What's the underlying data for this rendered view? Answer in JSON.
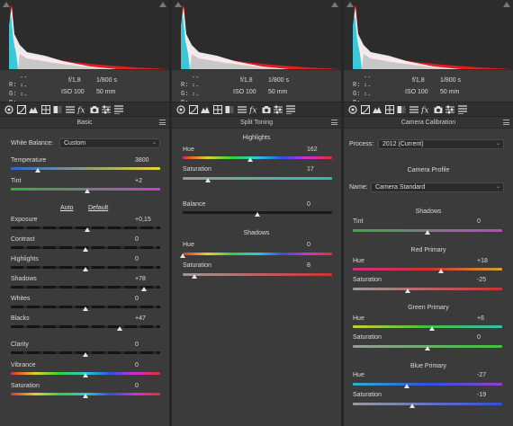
{
  "info": {
    "r_label": "R:",
    "g_label": "G:",
    "b_label": "B:",
    "r": "---",
    "g": "---",
    "b": "---",
    "aperture": "f/1,8",
    "shutter": "1/800 s",
    "iso": "ISO 100",
    "focal": "50 mm"
  },
  "colors": {
    "track_gray": "#1a1a1a",
    "temp": [
      "#2f66c8",
      "#e8d43a"
    ],
    "tint": [
      "#2fb23a",
      "#c63fd0"
    ],
    "rainbow": [
      "#e03030",
      "#e0d030",
      "#30d040",
      "#30c8d8",
      "#3050e0",
      "#d030d0",
      "#e03030"
    ]
  },
  "basic": {
    "title": "Basic",
    "wb_label": "White Balance:",
    "wb_value": "Custom",
    "temp_label": "Temperature",
    "temp_value": "3800",
    "temp_pos": 0.18,
    "tint_label": "Tint",
    "tint_value": "+2",
    "tint_pos": 0.51,
    "auto": "Auto",
    "default": "Default",
    "rows": [
      {
        "label": "Exposure",
        "value": "+0,15",
        "pos": 0.51
      },
      {
        "label": "Contrast",
        "value": "0",
        "pos": 0.5
      },
      {
        "label": "Highlights",
        "value": "0",
        "pos": 0.5
      },
      {
        "label": "Shadows",
        "value": "+78",
        "pos": 0.89
      },
      {
        "label": "Whites",
        "value": "0",
        "pos": 0.5
      },
      {
        "label": "Blacks",
        "value": "+47",
        "pos": 0.73
      }
    ],
    "presence": [
      {
        "label": "Clarity",
        "value": "0",
        "pos": 0.5
      },
      {
        "label": "Vibrance",
        "value": "0",
        "pos": 0.5
      },
      {
        "label": "Saturation",
        "value": "0",
        "pos": 0.5
      }
    ]
  },
  "split": {
    "title": "Split Toning",
    "highlights_head": "Highlights",
    "h_hue_label": "Hue",
    "h_hue_value": "162",
    "h_hue_pos": 0.45,
    "h_sat_label": "Saturation",
    "h_sat_value": "17",
    "h_sat_pos": 0.17,
    "balance_label": "Balance",
    "balance_value": "0",
    "balance_pos": 0.5,
    "shadows_head": "Shadows",
    "s_hue_label": "Hue",
    "s_hue_value": "0",
    "s_hue_pos": 0.0,
    "s_sat_label": "Saturation",
    "s_sat_value": "8",
    "s_sat_pos": 0.08
  },
  "calib": {
    "title": "Camera Calibration",
    "process_label": "Process:",
    "process_value": "2012 (Current)",
    "profile_head": "Camera Profile",
    "name_label": "Name:",
    "name_value": "Camera Standard",
    "shadows_head": "Shadows",
    "tint_label": "Tint",
    "tint_value": "0",
    "tint_pos": 0.5,
    "red_head": "Red Primary",
    "red_hue_label": "Hue",
    "red_hue_value": "+18",
    "red_hue_pos": 0.59,
    "red_sat_label": "Saturation",
    "red_sat_value": "-25",
    "red_sat_pos": 0.37,
    "green_head": "Green Primary",
    "green_hue_label": "Hue",
    "green_hue_value": "+6",
    "green_hue_pos": 0.53,
    "green_sat_label": "Saturation",
    "green_sat_value": "0",
    "green_sat_pos": 0.5,
    "blue_head": "Blue Primary",
    "blue_hue_label": "Hue",
    "blue_hue_value": "-27",
    "blue_hue_pos": 0.36,
    "blue_sat_label": "Saturation",
    "blue_sat_value": "-19",
    "blue_sat_pos": 0.4
  },
  "tool_icons": [
    "aperture-icon",
    "tone-curve-icon",
    "mountain-icon",
    "grid-icon",
    "split-icon",
    "lines-icon",
    "fx-icon",
    "camera-icon",
    "sliders-icon",
    "presets-icon"
  ]
}
